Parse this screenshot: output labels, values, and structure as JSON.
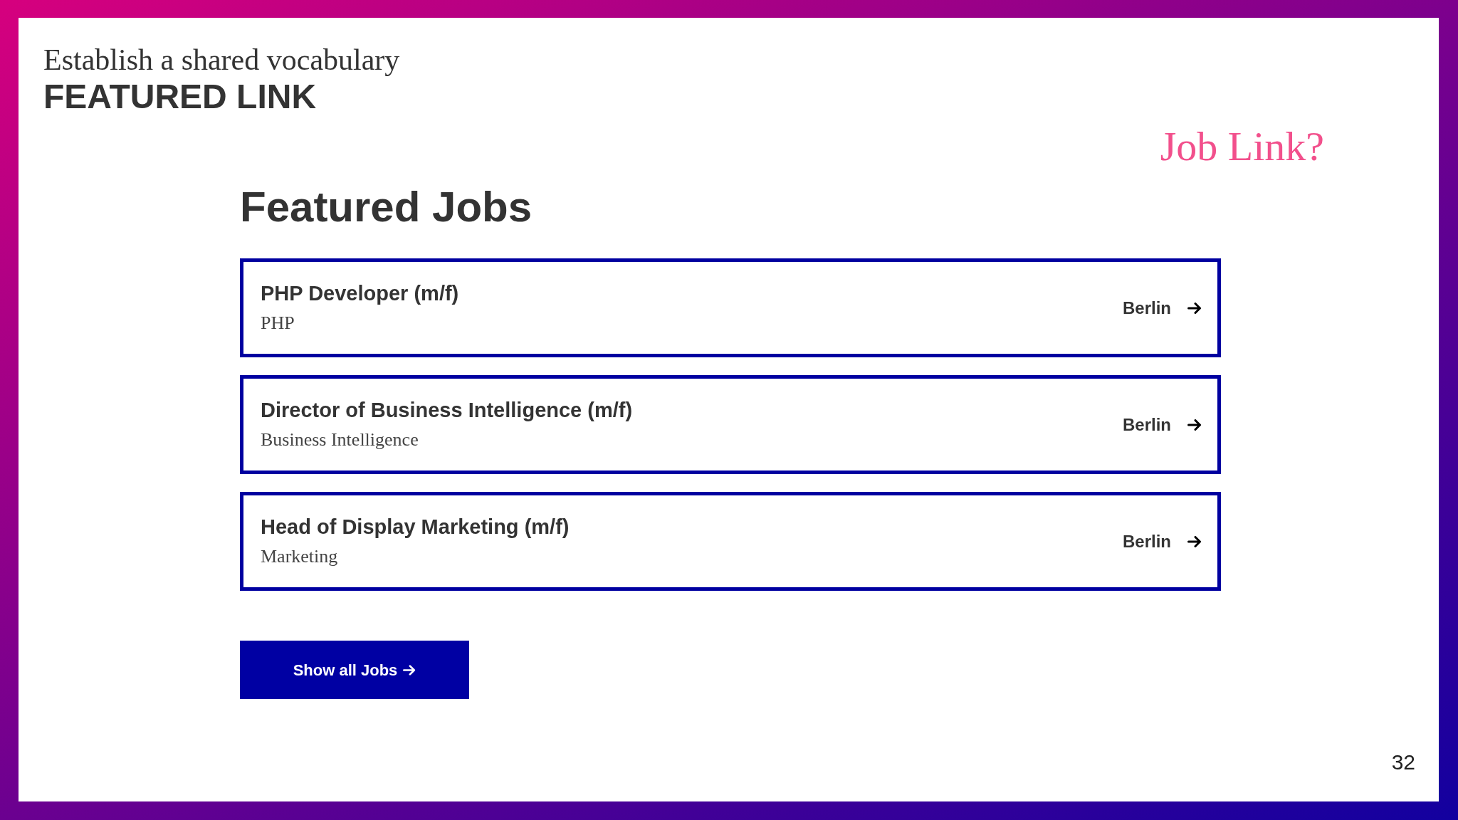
{
  "slide": {
    "subtitle": "Establish a shared vocabulary",
    "title": "FEATURED LINK",
    "annotation": "Job Link?",
    "page_number": "32"
  },
  "featured_jobs": {
    "heading": "Featured Jobs",
    "jobs": [
      {
        "title": "PHP Developer (m/f)",
        "category": "PHP",
        "location": "Berlin"
      },
      {
        "title": "Director of Business Intelligence (m/f)",
        "category": "Business Intelligence",
        "location": "Berlin"
      },
      {
        "title": "Head of Display Marketing (m/f)",
        "category": "Marketing",
        "location": "Berlin"
      }
    ],
    "button": {
      "label": "Show all Jobs"
    }
  }
}
